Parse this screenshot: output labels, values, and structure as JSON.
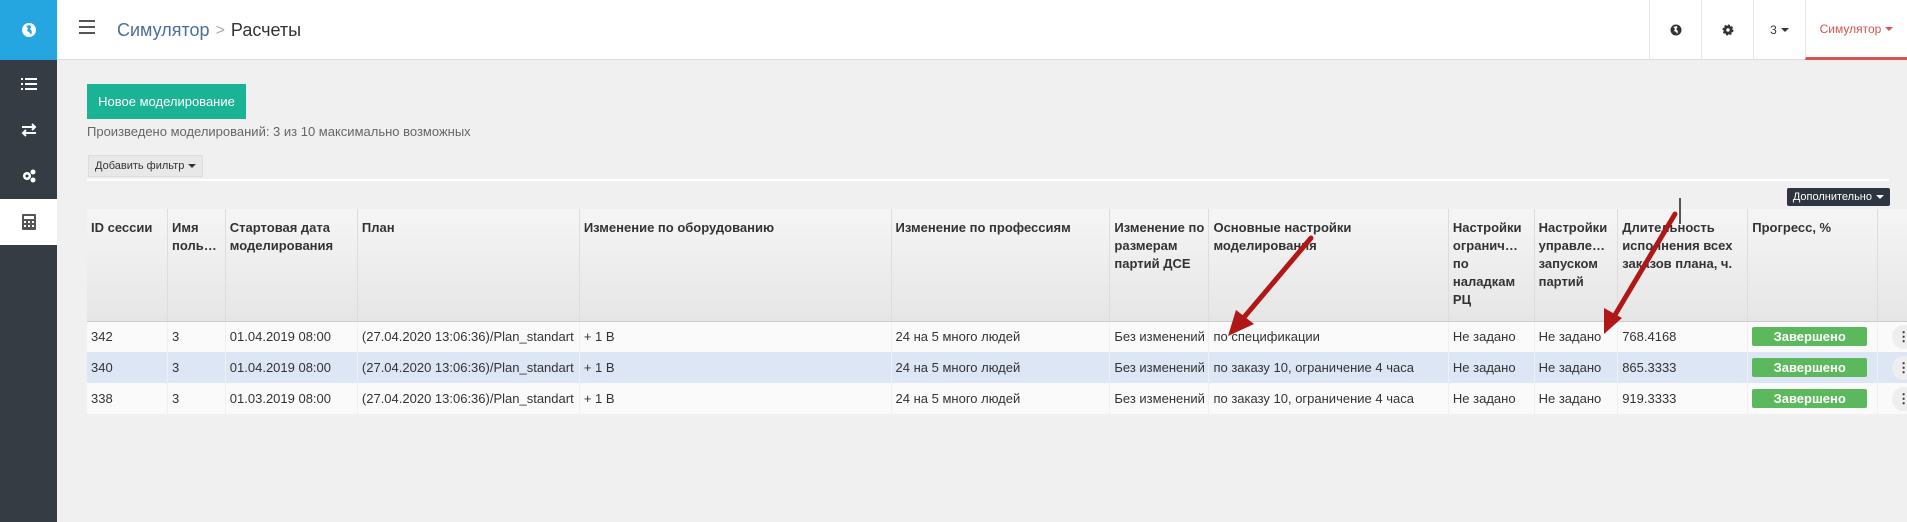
{
  "header": {
    "breadcrumb_root": "Симулятор",
    "breadcrumb_sep": ">",
    "breadcrumb_current": "Расчеты",
    "page_num": "3",
    "user_label": "Симулятор"
  },
  "sidebar": {
    "items": [
      {
        "icon": "globe-icon"
      },
      {
        "icon": "list-icon"
      },
      {
        "icon": "exchange-icon"
      },
      {
        "icon": "gears-icon"
      },
      {
        "icon": "calculator-icon"
      }
    ]
  },
  "toolbar": {
    "new_button": "Новое моделирование",
    "info_text": "Произведено моделирований: 3 из 10 максимально возможных",
    "filter_button": "Добавить фильтр",
    "extra_button": "Дополнительно"
  },
  "table": {
    "columns": [
      "ID сессии",
      "Имя поль…",
      "Стартовая дата моделирования",
      "План",
      "Изменение по оборудованию",
      "Изменение по профессиям",
      "Изменение по размерам партий ДСЕ",
      "Основные настройки моделирования",
      "Настройки огранич… по наладкам РЦ",
      "Настройки управле… запуском партий",
      "Длительность исполнения всех заказов плана, ч.",
      "Прогресс, %",
      ""
    ],
    "rows": [
      [
        "342",
        "3",
        "01.04.2019 08:00",
        "(27.04.2020 13:06:36)/Plan_standart",
        "+ 1 В",
        "24 на 5 много людей",
        "Без изменений",
        "по спецификации",
        "Не задано",
        "Не задано",
        "768.4168",
        "Завершено"
      ],
      [
        "340",
        "3",
        "01.04.2019 08:00",
        "(27.04.2020 13:06:36)/Plan_standart",
        "+ 1 В",
        "24 на 5 много людей",
        "Без изменений",
        "по заказу 10, ограничение 4 часа",
        "Не задано",
        "Не задано",
        "865.3333",
        "Завершено"
      ],
      [
        "338",
        "3",
        "01.03.2019 08:00",
        "(27.04.2020 13:06:36)/Plan_standart",
        "+ 1 В",
        "24 на 5 много людей",
        "Без изменений",
        "по заказу 10, ограничение 4 часа",
        "Не задано",
        "Не задано",
        "919.3333",
        "Завершено"
      ]
    ]
  },
  "colors": {
    "accent": "#1ab394",
    "sidebar": "#363c44",
    "logo": "#26a6e1",
    "status_done": "#5cb85c",
    "annotation_arrow": "#b01818"
  }
}
